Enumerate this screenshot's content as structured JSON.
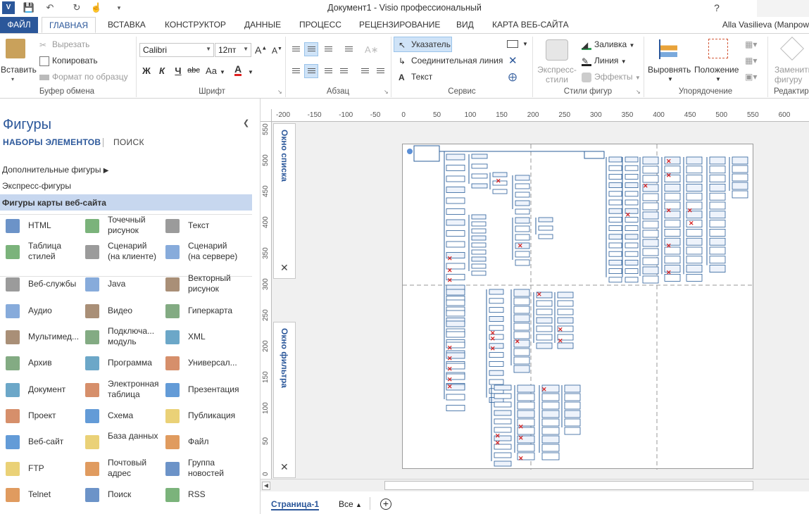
{
  "window": {
    "title": "Документ1 -  Visio профессиональный",
    "user": "Alla Vasilieva (Manpow"
  },
  "ribbon_tabs": [
    "ФАЙЛ",
    "ГЛАВНАЯ",
    "ВСТАВКА",
    "КОНСТРУКТОР",
    "ДАННЫЕ",
    "ПРОЦЕСС",
    "РЕЦЕНЗИРОВАНИЕ",
    "ВИД",
    "КАРТА ВЕБ-САЙТА"
  ],
  "clipboard": {
    "paste": "Вставить",
    "cut": "Вырезать",
    "copy": "Копировать",
    "format_painter": "Формат по образцу",
    "label": "Буфер обмена"
  },
  "font": {
    "name": "Calibri",
    "size": "12пт",
    "bold": "Ж",
    "italic": "К",
    "underline": "Ч",
    "strike": "abc",
    "case": "Аа",
    "label": "Шрифт"
  },
  "paragraph": {
    "label": "Абзац"
  },
  "tools": {
    "pointer": "Указатель",
    "connector": "Соединительная линия",
    "text": "Текст",
    "label": "Сервис"
  },
  "shape_styles": {
    "express": "Экспресс-стили",
    "fill": "Заливка",
    "line": "Линия",
    "effects": "Эффекты",
    "label": "Стили фигур"
  },
  "arrange": {
    "align": "Выровнять",
    "position": "Положение",
    "label": "Упорядочение"
  },
  "editing": {
    "change_shape": "Заменить фигуру",
    "label": "Редактир"
  },
  "sidebar": {
    "title": "Фигуры",
    "tab_sets": "НАБОРЫ ЭЛЕМЕНТОВ",
    "tab_search": "ПОИСК",
    "stencils": [
      "Дополнительные фигуры",
      "Экспресс-фигуры",
      "Фигуры карты веб-сайта"
    ],
    "shapes": [
      [
        "HTML",
        "Точечный рисунок",
        "Текст"
      ],
      [
        "Таблица стилей",
        "Сценарий (на клиенте)",
        "Сценарий (на сервере)"
      ],
      [
        "Веб-службы",
        "Java",
        "Векторный рисунок"
      ],
      [
        "Аудио",
        "Видео",
        "Гиперкарта"
      ],
      [
        "Мультимед...",
        "Подключа... модуль",
        "XML"
      ],
      [
        "Архив",
        "Программа",
        "Универсал..."
      ],
      [
        "Документ",
        "Электронная таблица",
        "Презентация"
      ],
      [
        "Проект",
        "Схема",
        "Публикация"
      ],
      [
        "Веб-сайт",
        "База данных",
        "Файл"
      ],
      [
        "FTP",
        "Почтовый адрес",
        "Группа новостей"
      ],
      [
        "Telnet",
        "Поиск",
        "RSS"
      ]
    ]
  },
  "panels": {
    "list": "Окно списка",
    "filter": "Окно фильтра"
  },
  "ruler": {
    "h": [
      "-200",
      "-150",
      "-100",
      "-50",
      "0",
      "50",
      "100",
      "150",
      "200",
      "250",
      "300",
      "350",
      "400",
      "450",
      "500",
      "550",
      "600"
    ],
    "v": [
      "550",
      "500",
      "450",
      "400",
      "350",
      "300",
      "250",
      "200",
      "150",
      "100",
      "50",
      "0"
    ]
  },
  "status": {
    "page_tab": "Страница-1",
    "all": "Все"
  },
  "colors": {
    "accent": "#2b579a",
    "selected": "#c7d7ef",
    "error_mark": "#d62424"
  }
}
